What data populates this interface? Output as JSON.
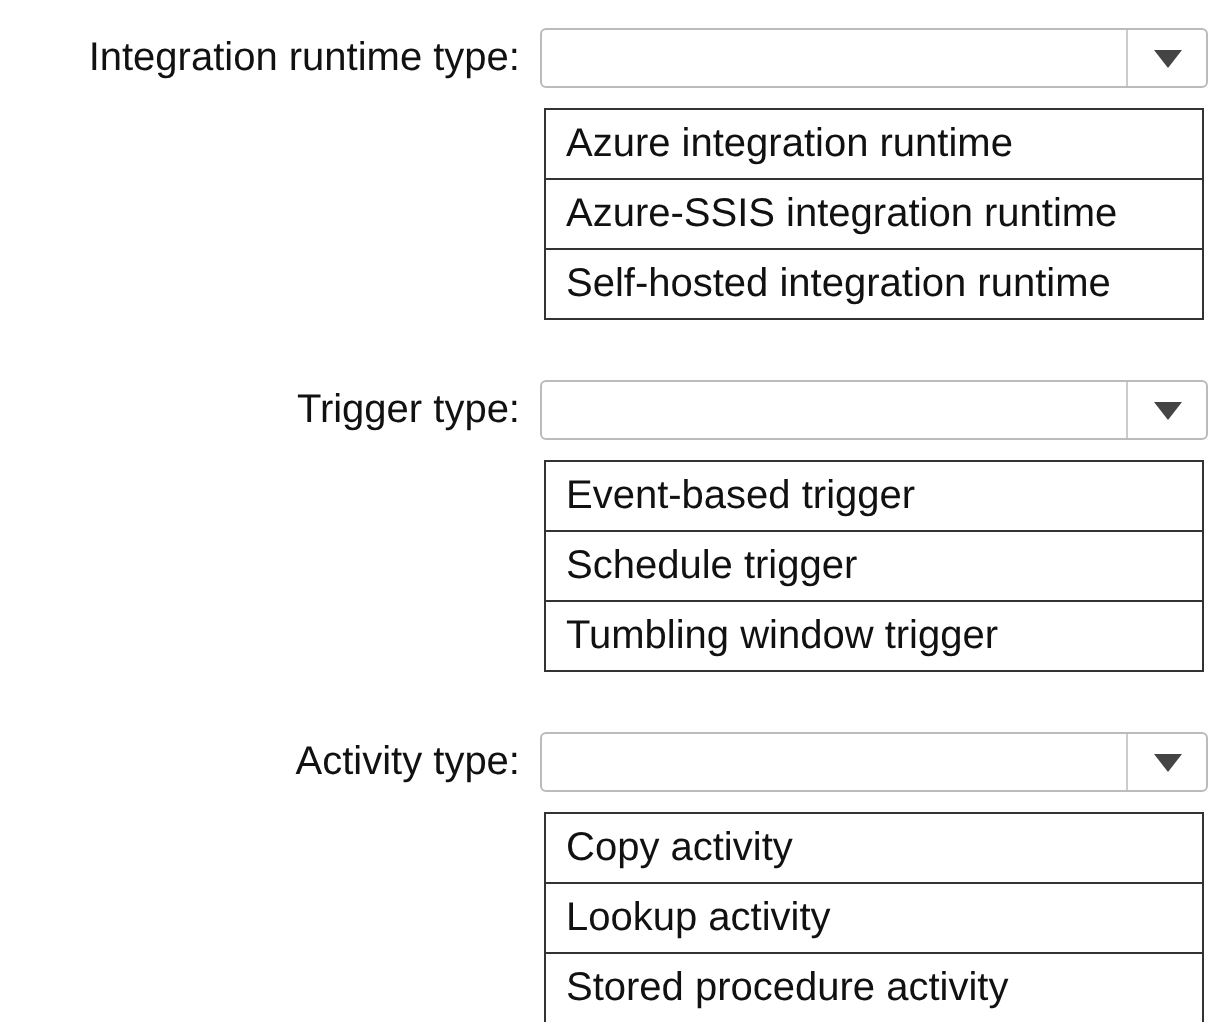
{
  "questions": [
    {
      "label": "Integration runtime type:",
      "options": [
        "Azure integration runtime",
        "Azure-SSIS integration runtime",
        "Self-hosted integration runtime"
      ]
    },
    {
      "label": "Trigger type:",
      "options": [
        "Event-based trigger",
        "Schedule trigger",
        "Tumbling window trigger"
      ]
    },
    {
      "label": "Activity type:",
      "options": [
        "Copy activity",
        "Lookup activity",
        "Stored procedure activity"
      ]
    }
  ]
}
